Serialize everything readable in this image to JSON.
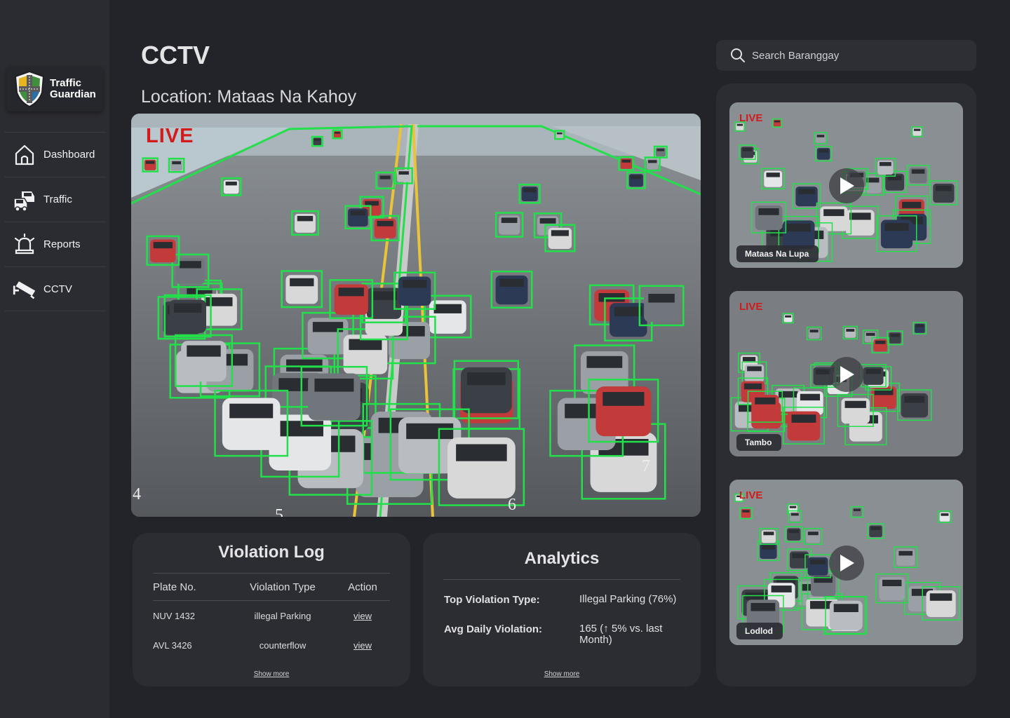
{
  "app": {
    "logo_line1": "Traffic",
    "logo_line2": "Guardian"
  },
  "sidebar": {
    "items": [
      {
        "label": "Dashboard",
        "icon": "home-icon"
      },
      {
        "label": "Traffic",
        "icon": "cars-icon"
      },
      {
        "label": "Reports",
        "icon": "alarm-bell-icon"
      },
      {
        "label": "CCTV",
        "icon": "cctv-camera-icon"
      }
    ]
  },
  "header": {
    "title": "CCTV",
    "location": "Location: Mataas Na Kahoy"
  },
  "search": {
    "placeholder": "Search Baranggay"
  },
  "main_feed": {
    "live_label": "LIVE"
  },
  "violation_log": {
    "title": "Violation Log",
    "columns": [
      "Plate No.",
      "Violation Type",
      "Action"
    ],
    "rows": [
      {
        "plate": "NUV 1432",
        "type": "illegal Parking",
        "action": "view"
      },
      {
        "plate": "AVL 3426",
        "type": "counterflow",
        "action": "view"
      }
    ],
    "show_more": "Show more"
  },
  "analytics": {
    "title": "Analytics",
    "rows": [
      {
        "key": "Top Violation Type:",
        "value": "Illegal Parking (76%)"
      },
      {
        "key": "Avg Daily Violation:",
        "value": "165 (↑ 5% vs. last Month)"
      }
    ],
    "show_more": "Show more"
  },
  "cameras": [
    {
      "live_label": "LIVE",
      "name": "Mataas Na Lupa"
    },
    {
      "live_label": "LIVE",
      "name": "Tambo"
    },
    {
      "live_label": "LIVE",
      "name": "Lodlod"
    }
  ],
  "colors": {
    "background": "#232429",
    "panel": "#2c2d32",
    "detection_box": "#22e04a",
    "live": "#d21b1b"
  }
}
